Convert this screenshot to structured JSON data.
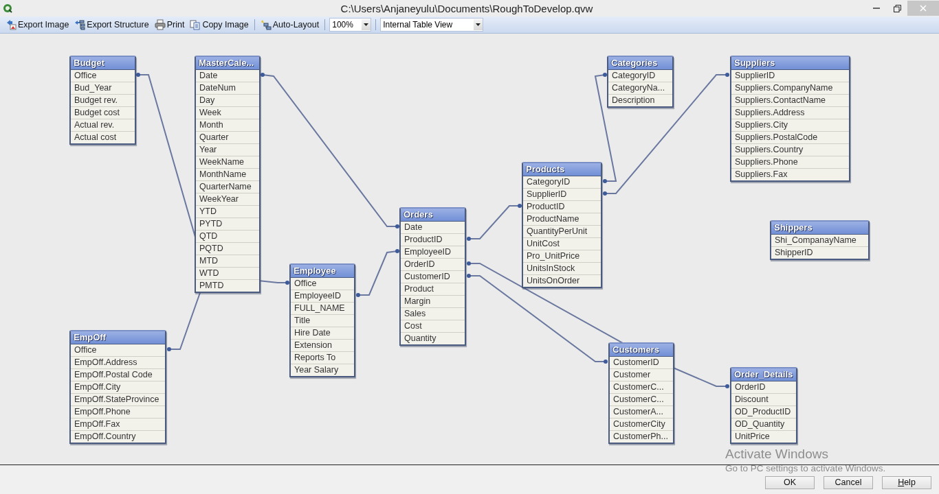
{
  "window": {
    "title": "C:\\Users\\Anjaneyulu\\Documents\\RoughToDevelop.qvw"
  },
  "toolbar": {
    "buttons": [
      {
        "kind": "export-image",
        "label": "Export Image"
      },
      {
        "kind": "export-structure",
        "label": "Export Structure"
      },
      {
        "kind": "print",
        "label": "Print"
      },
      {
        "kind": "copy-image",
        "label": "Copy Image"
      },
      {
        "kind": "auto-layout",
        "label": "Auto-Layout"
      }
    ],
    "zoom": {
      "value": "100%"
    },
    "view": {
      "value": "Internal Table View"
    }
  },
  "tables": [
    {
      "name": "Budget",
      "fields": [
        "Office",
        "Bud_Year",
        "Budget rev.",
        "Budget cost",
        "Actual rev.",
        "Actual cost"
      ]
    },
    {
      "name": "MasterCale...",
      "fields": [
        "Date",
        "DateNum",
        "Day",
        "Week",
        "Month",
        "Quarter",
        "Year",
        "WeekName",
        "MonthName",
        "QuarterName",
        "WeekYear",
        "YTD",
        "PYTD",
        "QTD",
        "PQTD",
        "MTD",
        "WTD",
        "PMTD"
      ]
    },
    {
      "name": "EmpOff",
      "fields": [
        "Office",
        "EmpOff.Address",
        "EmpOff.Postal Code",
        "EmpOff.City",
        "EmpOff.StateProvince",
        "EmpOff.Phone",
        "EmpOff.Fax",
        "EmpOff.Country"
      ]
    },
    {
      "name": "Employee",
      "fields": [
        "Office",
        "EmployeeID",
        "FULL_NAME",
        "Title",
        "Hire Date",
        "Extension",
        "Reports To",
        "Year Salary"
      ]
    },
    {
      "name": "Orders",
      "fields": [
        "Date",
        "ProductID",
        "EmployeeID",
        "OrderID",
        "CustomerID",
        "Product",
        "Margin",
        "Sales",
        "Cost",
        "Quantity"
      ]
    },
    {
      "name": "Products",
      "fields": [
        "CategoryID",
        "SupplierID",
        "ProductID",
        "ProductName",
        "QuantityPerUnit",
        "UnitCost",
        "Pro_UnitPrice",
        "UnitsInStock",
        "UnitsOnOrder"
      ]
    },
    {
      "name": "Categories",
      "fields": [
        "CategoryID",
        "CategoryNa...",
        "Description"
      ]
    },
    {
      "name": "Suppliers",
      "fields": [
        "SupplierID",
        "Suppliers.CompanyName",
        "Suppliers.ContactName",
        "Suppliers.Address",
        "Suppliers.City",
        "Suppliers.PostalCode",
        "Suppliers.Country",
        "Suppliers.Phone",
        "Suppliers.Fax"
      ]
    },
    {
      "name": "Shippers",
      "fields": [
        "Shi_CompanayName",
        "ShipperID"
      ]
    },
    {
      "name": "Customers",
      "fields": [
        "CustomerID",
        "Customer",
        "CustomerC...",
        "CustomerC...",
        "CustomerA...",
        "CustomerCity",
        "CustomerPh..."
      ]
    },
    {
      "name": "Order_Details",
      "fields": [
        "OrderID",
        "Discount",
        "OD_ProductID",
        "OD_Quantity",
        "UnitPrice"
      ]
    }
  ],
  "buttons": [
    {
      "label": "OK",
      "first_letter_underlined": false
    },
    {
      "label": "Cancel",
      "first_letter_underlined": false
    },
    {
      "label": "Help",
      "first_letter_underlined": true
    }
  ],
  "os_notice": {
    "title": "Activate Windows",
    "text": "Go to PC settings to activate Windows."
  }
}
